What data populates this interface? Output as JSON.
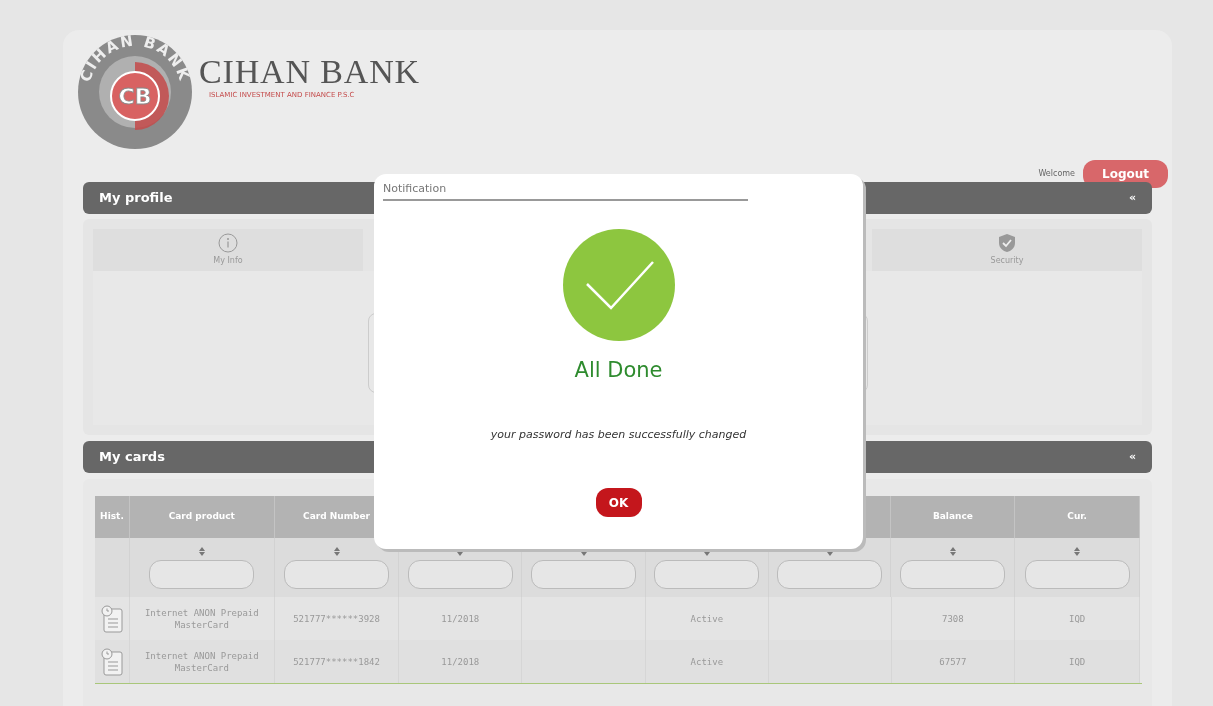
{
  "brand": {
    "ring_text": "CIHAN BANK",
    "monogram": "CB",
    "name": "CIHAN BANK",
    "tagline": "ISLAMIC INVESTMENT AND FINANCE P.S.C"
  },
  "header": {
    "welcome": "Welcome",
    "logout": "Logout"
  },
  "profile": {
    "title": "My profile",
    "collapse": "«",
    "tabs": [
      {
        "label": "My Info"
      },
      {
        "label": "Security"
      }
    ]
  },
  "cards": {
    "title": "My cards",
    "collapse": "«",
    "columns": [
      {
        "label": "Hist."
      },
      {
        "label": "Card product"
      },
      {
        "label": "Card Number"
      },
      {},
      {},
      {},
      {},
      {
        "label": "Balance"
      },
      {
        "label": "Cur."
      }
    ],
    "rows": [
      {
        "cells": [
          "",
          "Internet ANON Prepaid MasterCard",
          "521777******3928",
          "11/2018",
          "",
          "Active",
          "",
          "7308",
          "IQD"
        ]
      },
      {
        "cells": [
          "",
          "Internet ANON Prepaid MasterCard",
          "521777******1842",
          "11/2018",
          "",
          "Active",
          "",
          "67577",
          "IQD"
        ]
      }
    ]
  },
  "dialog": {
    "title": "Notification",
    "heading": "All Done",
    "message": "your password has been successfully changed",
    "button": "OK"
  }
}
